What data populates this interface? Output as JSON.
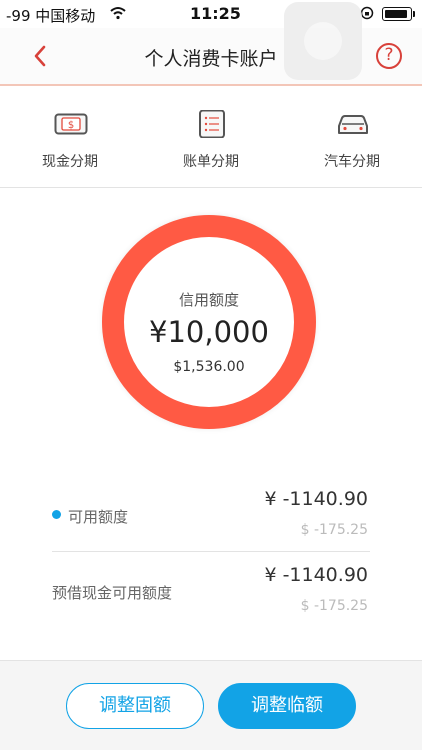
{
  "status_bar": {
    "signal": "-99 中国移动",
    "time": "11:25"
  },
  "nav": {
    "title": "个人消费卡账户",
    "help_glyph": "?"
  },
  "categories": [
    {
      "label": "现金分期",
      "icon": "cash-icon"
    },
    {
      "label": "账单分期",
      "icon": "bill-icon"
    },
    {
      "label": "汽车分期",
      "icon": "car-icon"
    }
  ],
  "credit": {
    "title": "信用额度",
    "amount": "¥10,000",
    "usd": "$1,536.00"
  },
  "rows": [
    {
      "label": "可用额度",
      "cny": "¥ -1140.90",
      "usd": "$ -175.25"
    },
    {
      "label": "预借现金可用额度",
      "cny": "¥ -1140.90",
      "usd": "$ -175.25"
    }
  ],
  "buttons": {
    "adjust_fixed": "调整固额",
    "adjust_temp": "调整临额"
  },
  "colors": {
    "accent_blue": "#12a3e6",
    "ring_red": "#ff5a44",
    "nav_red": "#d8413a"
  }
}
